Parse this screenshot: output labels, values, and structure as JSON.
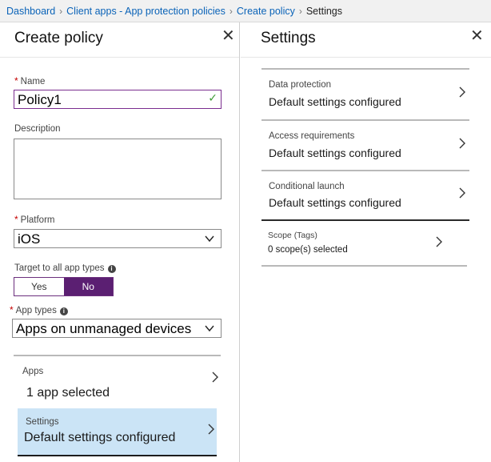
{
  "breadcrumb": {
    "items": [
      "Dashboard",
      "Client apps - App protection policies",
      "Create policy",
      "Settings"
    ]
  },
  "create_policy": {
    "title": "Create policy",
    "close": "✕",
    "name": {
      "label": "Name",
      "required_mark": "*",
      "value": "Policy1",
      "valid_mark": "✓"
    },
    "description": {
      "label": "Description",
      "value": ""
    },
    "platform": {
      "label": "Platform",
      "required_mark": "*",
      "value": "iOS"
    },
    "target_all": {
      "label": "Target to all app types",
      "info_icon": "i",
      "options": [
        "Yes",
        "No"
      ],
      "selected": "No"
    },
    "app_types": {
      "label": "App types",
      "required_mark": "*",
      "info_icon": "i",
      "value": "Apps on unmanaged devices"
    },
    "apps": {
      "label": "Apps",
      "value": "1 app selected"
    },
    "settings": {
      "label": "Settings",
      "value": "Default settings configured"
    }
  },
  "settings_blade": {
    "title": "Settings",
    "close": "✕",
    "rows": [
      {
        "label": "Data protection",
        "value": "Default settings configured"
      },
      {
        "label": "Access requirements",
        "value": "Default settings configured"
      },
      {
        "label": "Conditional launch",
        "value": "Default settings configured"
      },
      {
        "label": "Scope (Tags)",
        "value": "0 scope(s) selected"
      }
    ]
  },
  "colors": {
    "link": "#0a63b8",
    "accent_purple": "#5b1f72",
    "required": "#c40000",
    "selected_row": "#cbe4f6",
    "check_green": "#3f9c35"
  }
}
